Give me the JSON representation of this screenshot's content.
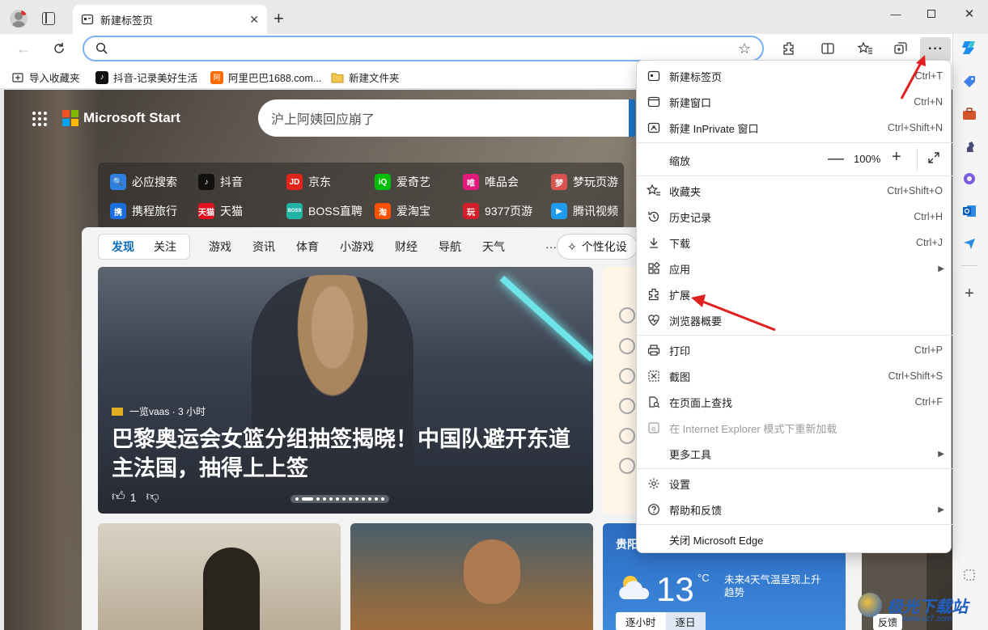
{
  "tab": {
    "title": "新建标签页"
  },
  "favorites": [
    {
      "label": "导入收藏夹",
      "icon": "import-icon"
    },
    {
      "label": "抖音-记录美好生活",
      "icon": "douyin-icon"
    },
    {
      "label": "阿里巴巴1688.com...",
      "icon": "alibaba-icon"
    },
    {
      "label": "新建文件夹",
      "icon": "folder-icon"
    }
  ],
  "page": {
    "brand": "Microsoft Start",
    "search_placeholder": "沪上阿姨回应崩了",
    "quick_links": [
      {
        "label": "必应搜索",
        "color": "#2f7fe0",
        "glyph": "🔍"
      },
      {
        "label": "抖音",
        "color": "#111111",
        "glyph": "♪"
      },
      {
        "label": "京东",
        "color": "#e1251b",
        "glyph": "JD"
      },
      {
        "label": "爱奇艺",
        "color": "#00be06",
        "glyph": "iQ"
      },
      {
        "label": "唯品会",
        "color": "#e31a7b",
        "glyph": "唯"
      },
      {
        "label": "梦玩页游",
        "color": "#d9534f",
        "glyph": "梦"
      },
      {
        "label": "携程旅行",
        "color": "#1b6fdc",
        "glyph": "携"
      },
      {
        "label": "天猫",
        "color": "#e0101f",
        "glyph": "天猫"
      },
      {
        "label": "BOSS直聘",
        "color": "#20b3a3",
        "glyph": "BOSS"
      },
      {
        "label": "爱淘宝",
        "color": "#ff5000",
        "glyph": "淘"
      },
      {
        "label": "9377页游",
        "color": "#d21f2b",
        "glyph": "玩"
      },
      {
        "label": "腾讯视频",
        "color": "#1e9bf0",
        "glyph": "▶"
      }
    ],
    "feed_tabs_active": [
      "发现",
      "关注"
    ],
    "feed_tabs": [
      "游戏",
      "资讯",
      "体育",
      "小游戏",
      "财经",
      "导航",
      "天气",
      "···"
    ],
    "personalize_label": "个性化设",
    "hero": {
      "source": "一览vaas · 3 小时",
      "title": "巴黎奥运会女篮分组抽签揭晓！中国队避开东道主法国，抽得上上签",
      "likes": "1"
    },
    "weather": {
      "city": "贵阳",
      "temp": "13",
      "unit": "°C",
      "note": "未来4天气温呈现上升趋势",
      "tabs": [
        "逐小时",
        "逐日"
      ]
    },
    "feedback_label": "反馈"
  },
  "menu": {
    "items": [
      {
        "label": "新建标签页",
        "shortcut": "Ctrl+T",
        "icon": "new-tab-icon"
      },
      {
        "label": "新建窗口",
        "shortcut": "Ctrl+N",
        "icon": "new-window-icon"
      },
      {
        "label": "新建 InPrivate 窗口",
        "shortcut": "Ctrl+Shift+N",
        "icon": "inprivate-icon"
      }
    ],
    "zoom": {
      "label": "缩放",
      "value": "100%",
      "minus": "—",
      "plus": "+"
    },
    "items2": [
      {
        "label": "收藏夹",
        "shortcut": "Ctrl+Shift+O",
        "icon": "star-icon"
      },
      {
        "label": "历史记录",
        "shortcut": "Ctrl+H",
        "icon": "history-icon"
      },
      {
        "label": "下载",
        "shortcut": "Ctrl+J",
        "icon": "download-icon"
      },
      {
        "label": "应用",
        "shortcut": "",
        "icon": "apps-icon",
        "submenu": true
      },
      {
        "label": "扩展",
        "shortcut": "",
        "icon": "extensions-icon"
      },
      {
        "label": "浏览器概要",
        "shortcut": "",
        "icon": "browser-essentials-icon"
      }
    ],
    "items3": [
      {
        "label": "打印",
        "shortcut": "Ctrl+P",
        "icon": "print-icon"
      },
      {
        "label": "截图",
        "shortcut": "Ctrl+Shift+S",
        "icon": "screenshot-icon"
      },
      {
        "label": "在页面上查找",
        "shortcut": "Ctrl+F",
        "icon": "find-icon"
      },
      {
        "label": "在 Internet Explorer 模式下重新加载",
        "shortcut": "",
        "icon": "ie-mode-icon",
        "disabled": true
      },
      {
        "label": "更多工具",
        "shortcut": "",
        "icon": "",
        "submenu": true
      }
    ],
    "items4": [
      {
        "label": "设置",
        "shortcut": "",
        "icon": "settings-icon"
      },
      {
        "label": "帮助和反馈",
        "shortcut": "",
        "icon": "help-icon",
        "submenu": true
      }
    ],
    "close_label": "关闭 Microsoft Edge"
  },
  "watermark": {
    "title": "极光下载站",
    "url": "www.xz7.com"
  },
  "colors": {
    "accent": "#0f6cbd",
    "arrow": "#e02020",
    "omnibox_border": "#7ab1ef"
  }
}
